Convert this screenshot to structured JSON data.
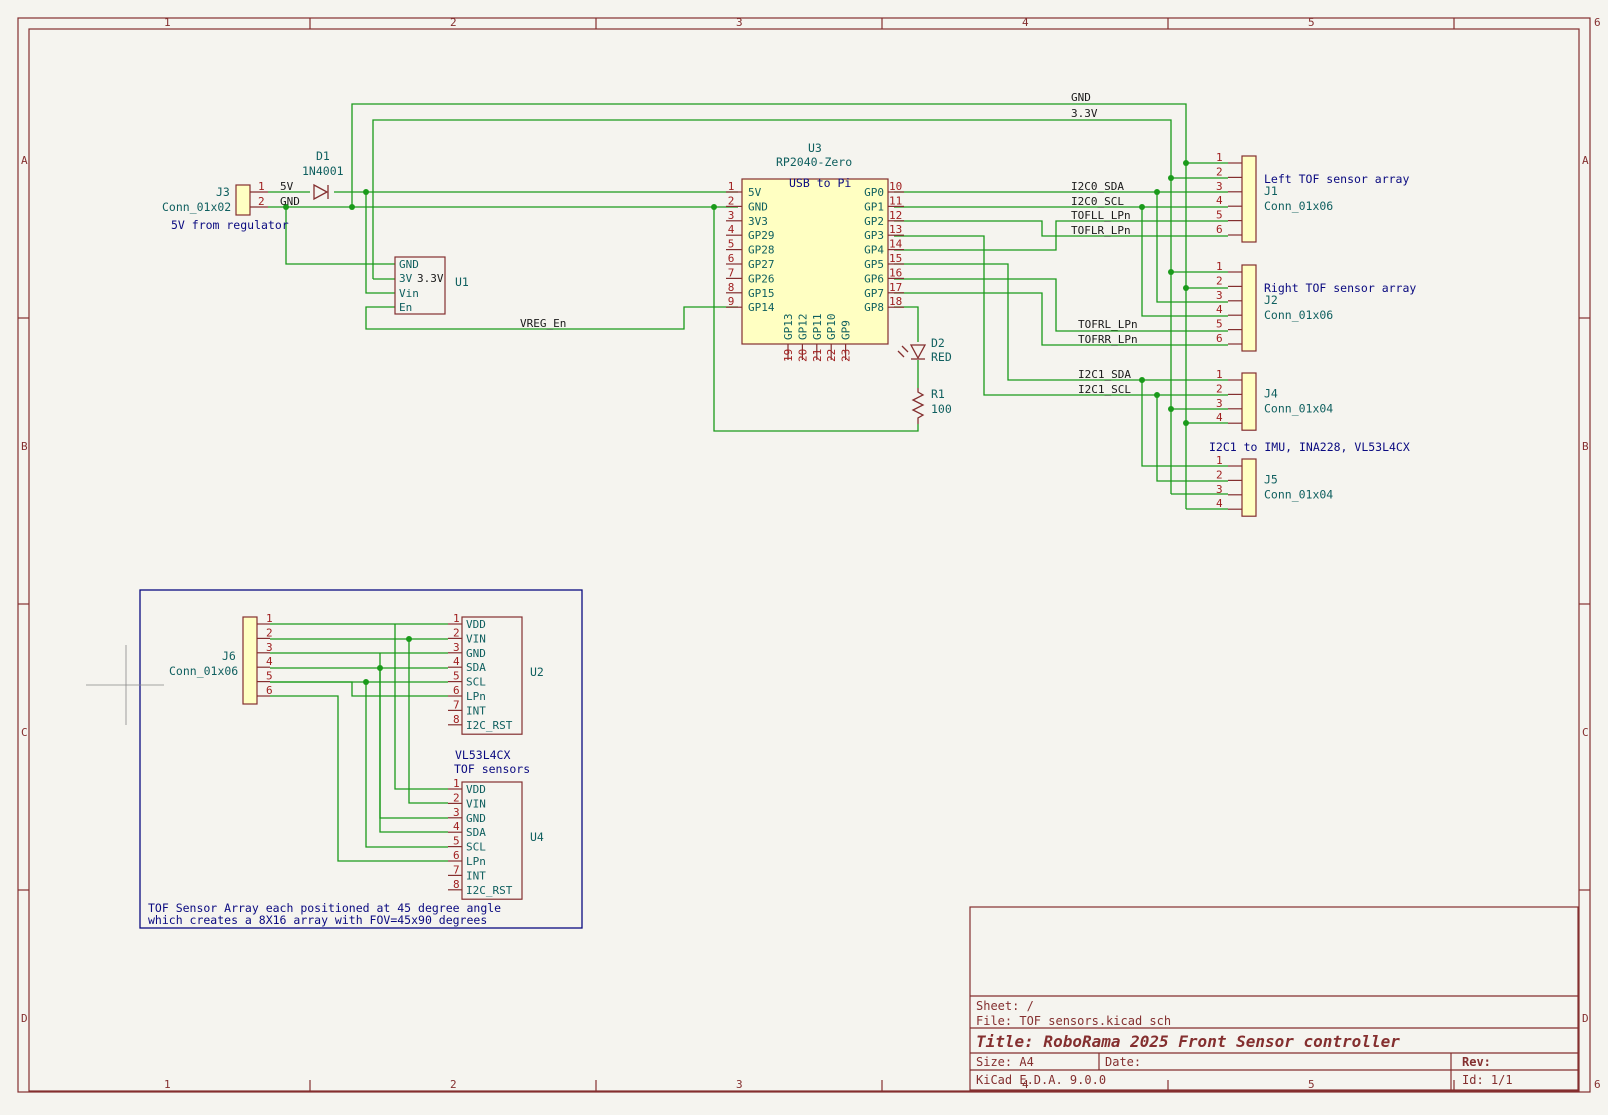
{
  "grid": {
    "cols": [
      "1",
      "2",
      "3",
      "4",
      "5",
      "6"
    ],
    "rows": [
      "A",
      "B",
      "C",
      "D"
    ]
  },
  "net_labels": {
    "gnd": "GND",
    "v33": "3.3V",
    "v5": "5V",
    "gnd_j3": "GND",
    "i2c0_sda": "I2C0_SDA",
    "i2c0_scl": "I2C0_SCL",
    "tofll": "TOFLL_LPn",
    "toflr": "TOFLR_LPn",
    "tofrl": "TOFRL_LPn",
    "tofrr": "TOFRR_LPn",
    "i2c1_sda": "I2C1_SDA",
    "i2c1_scl": "I2C1_SCL",
    "vreg": "VREG_En"
  },
  "j3": {
    "ref": "J3",
    "value": "Conn_01x02",
    "note": "5V from regulator",
    "pins": [
      "1",
      "2"
    ]
  },
  "d1": {
    "ref": "D1",
    "value": "1N4001"
  },
  "u1": {
    "ref": "U1",
    "pins": [
      {
        "name": "GND"
      },
      {
        "name": "3V"
      },
      {
        "name": "Vin"
      },
      {
        "name": "En"
      }
    ],
    "extra": "3.3V"
  },
  "u3": {
    "ref": "U3",
    "value": "RP2040-Zero",
    "title": "USB to Pi",
    "left_pins": [
      {
        "num": "1",
        "name": "5V"
      },
      {
        "num": "2",
        "name": "GND"
      },
      {
        "num": "3",
        "name": "3V3"
      },
      {
        "num": "4",
        "name": "GP29"
      },
      {
        "num": "5",
        "name": "GP28"
      },
      {
        "num": "6",
        "name": "GP27"
      },
      {
        "num": "7",
        "name": "GP26"
      },
      {
        "num": "8",
        "name": "GP15"
      },
      {
        "num": "9",
        "name": "GP14"
      }
    ],
    "right_pins": [
      {
        "num": "10",
        "name": "GP0"
      },
      {
        "num": "11",
        "name": "GP1"
      },
      {
        "num": "12",
        "name": "GP2"
      },
      {
        "num": "13",
        "name": "GP3"
      },
      {
        "num": "14",
        "name": "GP4"
      },
      {
        "num": "15",
        "name": "GP5"
      },
      {
        "num": "16",
        "name": "GP6"
      },
      {
        "num": "17",
        "name": "GP7"
      },
      {
        "num": "18",
        "name": "GP8"
      }
    ],
    "bottom_pins": [
      {
        "num": "19",
        "name": "GP13"
      },
      {
        "num": "20",
        "name": "GP12"
      },
      {
        "num": "21",
        "name": "GP11"
      },
      {
        "num": "22",
        "name": "GP10"
      },
      {
        "num": "23",
        "name": "GP9"
      }
    ]
  },
  "d2": {
    "ref": "D2",
    "value": "RED"
  },
  "r1": {
    "ref": "R1",
    "value": "100"
  },
  "connectors": [
    {
      "ref": "J1",
      "value": "Conn_01x06",
      "note": "Left TOF sensor array",
      "pins": [
        "1",
        "2",
        "3",
        "4",
        "5",
        "6"
      ]
    },
    {
      "ref": "J2",
      "value": "Conn_01x06",
      "note": "Right TOF sensor array",
      "pins": [
        "1",
        "2",
        "3",
        "4",
        "5",
        "6"
      ]
    },
    {
      "ref": "J4",
      "value": "Conn_01x04",
      "note": "",
      "pins": [
        "1",
        "2",
        "3",
        "4"
      ]
    },
    {
      "ref": "J5",
      "value": "Conn_01x04",
      "note": "I2C1 to IMU, INA228, VL53L4CX",
      "pins": [
        "1",
        "2",
        "3",
        "4"
      ]
    }
  ],
  "j6": {
    "ref": "J6",
    "value": "Conn_01x06",
    "pins": [
      "1",
      "2",
      "3",
      "4",
      "5",
      "6"
    ]
  },
  "tof_sensors": [
    {
      "ref": "U2",
      "pins": [
        {
          "num": "1",
          "name": "VDD"
        },
        {
          "num": "2",
          "name": "VIN"
        },
        {
          "num": "3",
          "name": "GND"
        },
        {
          "num": "4",
          "name": "SDA"
        },
        {
          "num": "5",
          "name": "SCL"
        },
        {
          "num": "6",
          "name": "LPn"
        },
        {
          "num": "7",
          "name": "INT"
        },
        {
          "num": "8",
          "name": "I2C_RST"
        }
      ]
    },
    {
      "ref": "U4",
      "pins": [
        {
          "num": "1",
          "name": "VDD"
        },
        {
          "num": "2",
          "name": "VIN"
        },
        {
          "num": "3",
          "name": "GND"
        },
        {
          "num": "4",
          "name": "SDA"
        },
        {
          "num": "5",
          "name": "SCL"
        },
        {
          "num": "6",
          "name": "LPn"
        },
        {
          "num": "7",
          "name": "INT"
        },
        {
          "num": "8",
          "name": "I2C_RST"
        }
      ]
    }
  ],
  "tof_value": [
    "VL53L4CX",
    "TOF sensors"
  ],
  "tof_note": [
    "TOF Sensor Array each positioned at 45 degree angle",
    "which creates a 8X16 array with FOV=45x90 degrees"
  ],
  "title_block": {
    "sheet": "Sheet: /",
    "file": "File: TOF sensors.kicad_sch",
    "title": "Title: RoboRama 2025 Front Sensor controller",
    "size": "Size: A4",
    "date": "Date:",
    "rev": "Rev:",
    "tool": "KiCad E.D.A. 9.0.0",
    "id": "Id: 1/1"
  }
}
